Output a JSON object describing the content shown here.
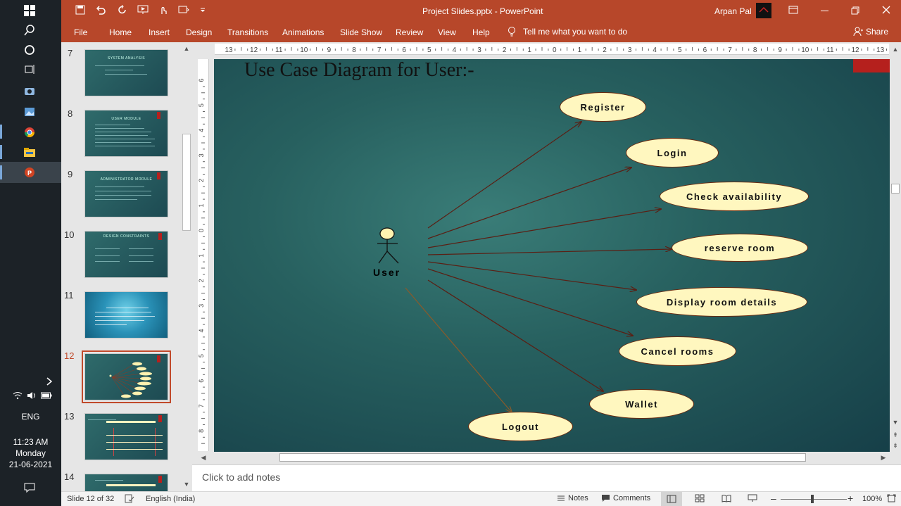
{
  "taskbar": {
    "tray_language": "ENG",
    "time": "11:23 AM",
    "day": "Monday",
    "date": "21-06-2021"
  },
  "window": {
    "title": "Project Slides.pptx  -  PowerPoint",
    "user": "Arpan Pal"
  },
  "ribbon": {
    "tabs": [
      "File",
      "Home",
      "Insert",
      "Design",
      "Transitions",
      "Animations",
      "Slide Show",
      "Review",
      "View",
      "Help"
    ],
    "tell_me": "Tell me what you want to do",
    "share": "Share"
  },
  "thumbnails": [
    {
      "num": "7",
      "title": "SYSTEM ANALYSIS"
    },
    {
      "num": "8",
      "title": "USER MODULE"
    },
    {
      "num": "9",
      "title": "ADMINISTRATOR MODULE"
    },
    {
      "num": "10",
      "title": "DESIGN CONSTRAINTS"
    },
    {
      "num": "11",
      "title": ""
    },
    {
      "num": "12",
      "title": ""
    },
    {
      "num": "13",
      "title": ""
    },
    {
      "num": "14",
      "title": ""
    }
  ],
  "ruler": {
    "h_ticks": [
      "13",
      "12",
      "11",
      "10",
      "9",
      "8",
      "7",
      "6",
      "5",
      "4",
      "3",
      "2",
      "1",
      "0",
      "1",
      "2",
      "3",
      "4",
      "5",
      "6",
      "7",
      "8",
      "9",
      "10",
      "11",
      "12",
      "13"
    ],
    "v_ticks": [
      "6",
      "5",
      "4",
      "3",
      "2",
      "1",
      "0",
      "1",
      "2",
      "3",
      "4",
      "5",
      "6",
      "7",
      "8"
    ]
  },
  "slide": {
    "title": "Use Case Diagram for User:-",
    "actor": "User",
    "use_cases": [
      "Register",
      "Login",
      "Check availability",
      "reserve room",
      "Display room details",
      "Cancel rooms",
      "Wallet",
      "Logout"
    ]
  },
  "notes_placeholder": "Click to add notes",
  "status": {
    "slide_counter": "Slide 12 of 32",
    "language": "English (India)",
    "notes": "Notes",
    "comments": "Comments",
    "zoom": "100%"
  }
}
